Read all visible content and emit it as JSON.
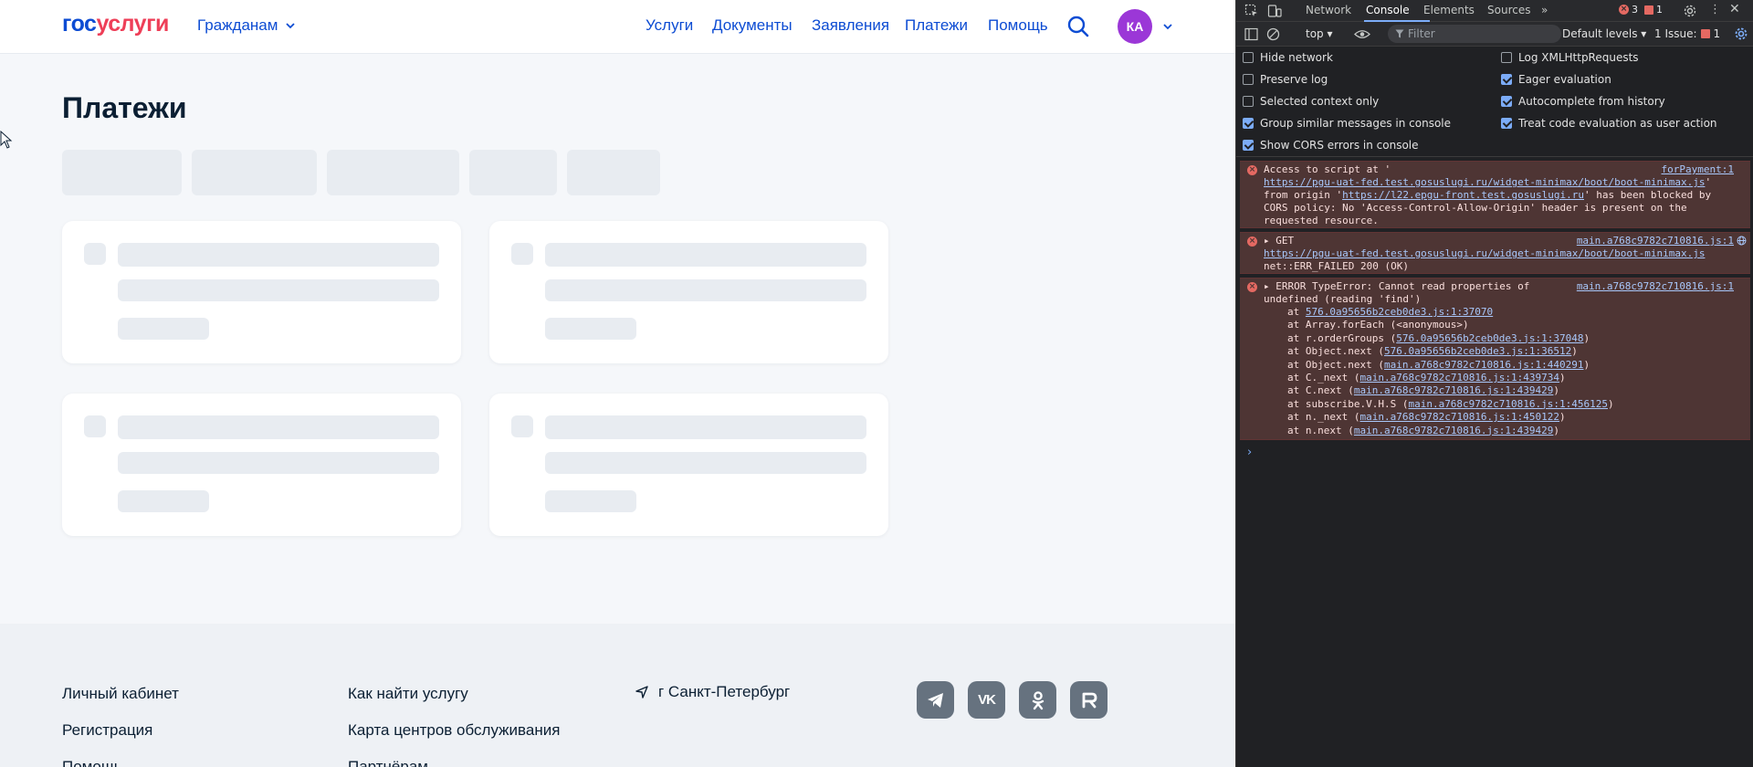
{
  "header": {
    "logo_part1": "гос",
    "logo_part2": "услуги",
    "audience": "Гражданам",
    "nav": [
      "Услуги",
      "Документы",
      "Заявления",
      "Платежи",
      "Помощь"
    ],
    "avatar_initials": "КА"
  },
  "main": {
    "title": "Платежи"
  },
  "footer": {
    "col1": [
      "Личный кабинет",
      "Регистрация",
      "Помощь"
    ],
    "col2": [
      "Как найти услугу",
      "Карта центров обслуживания",
      "Партнёрам"
    ],
    "city": "г Санкт-Петербург",
    "socials": [
      "telegram-icon",
      "vk-icon",
      "ok-icon",
      "rutube-icon"
    ]
  },
  "devtools": {
    "tabs": [
      "Network",
      "Console",
      "Elements",
      "Sources"
    ],
    "error_count": "3",
    "issue_count": "1",
    "context": "top",
    "filter_placeholder": "Filter",
    "levels": "Default levels",
    "issues_label": "1 Issue:",
    "issues_badge": "1",
    "settings_left": [
      {
        "label": "Hide network",
        "checked": false
      },
      {
        "label": "Preserve log",
        "checked": false
      },
      {
        "label": "Selected context only",
        "checked": false
      },
      {
        "label": "Group similar messages in console",
        "checked": true
      },
      {
        "label": "Show CORS errors in console",
        "checked": true
      }
    ],
    "settings_right": [
      {
        "label": "Log XMLHttpRequests",
        "checked": false
      },
      {
        "label": "Eager evaluation",
        "checked": true
      },
      {
        "label": "Autocomplete from history",
        "checked": true
      },
      {
        "label": "Treat code evaluation as user action",
        "checked": true
      }
    ],
    "messages": {
      "m1_source": "forPayment:1",
      "m1_l1": "Access to script at '",
      "m1_l2": "https://pgu-uat-fed.test.gosuslugi.ru/widget-minimax/boot/boot-minimax.js",
      "m1_l2b": "'",
      "m1_l3a": "from origin '",
      "m1_l3b": "https://l22.epgu-front.test.gosuslugi.ru",
      "m1_l3c": "' has been blocked by",
      "m1_l4": "CORS policy: No 'Access-Control-Allow-Origin' header is present on the",
      "m1_l5": "requested resource.",
      "m2_source": "main.a768c9782c710816.js:1",
      "m2_l1": "GET",
      "m2_l2": "https://pgu-uat-fed.test.gosuslugi.ru/widget-minimax/boot/boot-minimax.js",
      "m2_l3": "net::ERR_FAILED 200 (OK)",
      "m3_source": "main.a768c9782c710816.js:1",
      "m3_l1": "ERROR TypeError: Cannot read properties of",
      "m3_l2": "undefined (reading 'find')",
      "stack": [
        {
          "pre": "at ",
          "link": "576.0a95656b2ceb0de3.js:1:37070",
          "post": ""
        },
        {
          "pre": "at Array.forEach (<anonymous>)",
          "link": "",
          "post": ""
        },
        {
          "pre": "at r.orderGroups (",
          "link": "576.0a95656b2ceb0de3.js:1:37048",
          "post": ")"
        },
        {
          "pre": "at Object.next (",
          "link": "576.0a95656b2ceb0de3.js:1:36512",
          "post": ")"
        },
        {
          "pre": "at Object.next (",
          "link": "main.a768c9782c710816.js:1:440291",
          "post": ")"
        },
        {
          "pre": "at C._next (",
          "link": "main.a768c9782c710816.js:1:439734",
          "post": ")"
        },
        {
          "pre": "at C.next (",
          "link": "main.a768c9782c710816.js:1:439429",
          "post": ")"
        },
        {
          "pre": "at subscribe.V.H.S (",
          "link": "main.a768c9782c710816.js:1:456125",
          "post": ")"
        },
        {
          "pre": "at n._next (",
          "link": "main.a768c9782c710816.js:1:450122",
          "post": ")"
        },
        {
          "pre": "at n.next (",
          "link": "main.a768c9782c710816.js:1:439429",
          "post": ")"
        }
      ]
    }
  }
}
